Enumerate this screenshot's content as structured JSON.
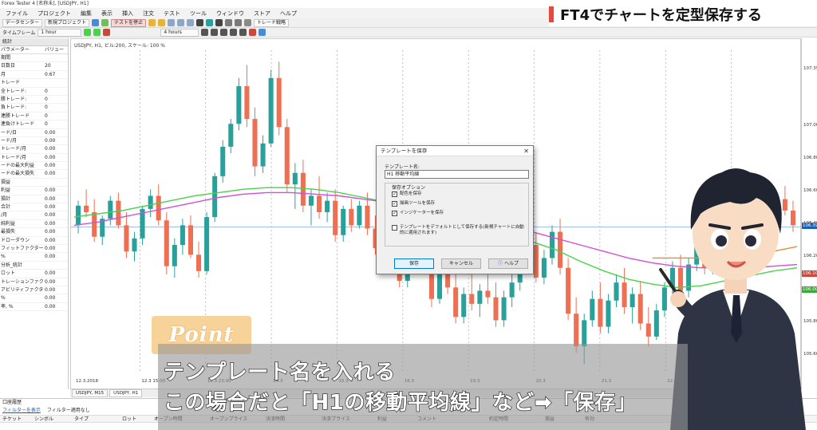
{
  "app": {
    "title": "Forex Tester 4 [名称未], [USDJPY, H1]"
  },
  "menu": [
    "ファイル",
    "プロジェクト",
    "編集",
    "表示",
    "挿入",
    "注文",
    "テスト",
    "ツール",
    "ウィンドウ",
    "ストア",
    "ヘルプ"
  ],
  "toolbar": {
    "data_center": "データセンター",
    "new_project": "新規プロジェクト",
    "test_start": "テストを停止",
    "timeframe_label": "タイムフレーム",
    "timeframe_value": "1 hour",
    "hours_value": "4 hours",
    "trade_strategy": "トレード戦略"
  },
  "banner": {
    "text": "FT4でチャートを定型保存する"
  },
  "left_panel": {
    "title": "統計",
    "col_param": "パラメーター",
    "col_value": "バリュー",
    "rows": [
      {
        "k": "期間",
        "v": ""
      },
      {
        "k": "日数日",
        "v": "20"
      },
      {
        "k": "月",
        "v": "0.67"
      },
      {
        "k": "トレード",
        "v": ""
      },
      {
        "k": "全トレード:",
        "v": "0"
      },
      {
        "k": "勝トレード:",
        "v": "0"
      },
      {
        "k": "負トレード:",
        "v": "0"
      },
      {
        "k": "連勝トレード",
        "v": "0"
      },
      {
        "k": "連負けトレード",
        "v": "0"
      },
      {
        "k": "ード/日",
        "v": "0.00"
      },
      {
        "k": "ード/月",
        "v": "0.00"
      },
      {
        "k": "トレード/月",
        "v": "0.00"
      },
      {
        "k": "トレード/月",
        "v": "0.00"
      },
      {
        "k": "ードの最大利益",
        "v": "0.00"
      },
      {
        "k": "ードの最大損失",
        "v": "0.00"
      },
      {
        "k": "損益",
        "v": ""
      },
      {
        "k": "利益",
        "v": "0.00"
      },
      {
        "k": "損計",
        "v": "0.00"
      },
      {
        "k": "合計",
        "v": "0.00"
      },
      {
        "k": "/月",
        "v": "0.00"
      },
      {
        "k": "純利益",
        "v": "0.00"
      },
      {
        "k": "最損失",
        "v": "0.00"
      },
      {
        "k": "ドローダウン",
        "v": "0.00"
      },
      {
        "k": "フィットファクター",
        "v": "0.00"
      },
      {
        "k": "%",
        "v": "0.00"
      },
      {
        "k": "分析_統計",
        "v": ""
      },
      {
        "k": "ロット",
        "v": "0.00"
      },
      {
        "k": "トレーションファクター",
        "v": "0.00"
      },
      {
        "k": "アビリティファクター",
        "v": "0.00"
      },
      {
        "k": "%",
        "v": "0.00"
      },
      {
        "k": "率, %",
        "v": "0.00"
      }
    ]
  },
  "chart": {
    "label": "USDJPY, H1, ビル:200, スケール: 100 %",
    "price_ticks": [
      "107.35",
      "107.00",
      "106.80",
      "106.60",
      "106.40",
      "106.20",
      "106.00",
      "105.80",
      "105.60"
    ],
    "price_badges": [
      {
        "text": "106.39",
        "color": "#1d5fb3"
      },
      {
        "text": "106.10",
        "color": "#c84a3a"
      },
      {
        "text": "106.00",
        "color": "#3aa83a"
      }
    ],
    "time_ticks": [
      "12.3.2018",
      "12.3 15:00",
      "12.3 23:00",
      "14.3",
      "15.3",
      "16.3",
      "19.3",
      "20.3",
      "21.3",
      "22.3",
      "23.3"
    ],
    "tabs": [
      "USDJPY, M15",
      "USDJPY, H1"
    ]
  },
  "chart_data": {
    "type": "candlestick",
    "title": "",
    "ylim": [
      105.5,
      107.45
    ],
    "up_color": "#2aa09a",
    "down_color": "#ef6f53",
    "candles": [
      [
        106.4,
        106.55,
        106.35,
        106.52
      ],
      [
        106.52,
        106.62,
        106.45,
        106.48
      ],
      [
        106.48,
        106.56,
        106.3,
        106.33
      ],
      [
        106.33,
        106.46,
        106.28,
        106.44
      ],
      [
        106.44,
        106.58,
        106.4,
        106.55
      ],
      [
        106.55,
        106.6,
        106.38,
        106.4
      ],
      [
        106.4,
        106.48,
        106.2,
        106.24
      ],
      [
        106.24,
        106.36,
        106.18,
        106.32
      ],
      [
        106.32,
        106.52,
        106.28,
        106.5
      ],
      [
        106.5,
        106.62,
        106.45,
        106.58
      ],
      [
        106.58,
        106.65,
        106.4,
        106.43
      ],
      [
        106.43,
        106.48,
        106.1,
        106.15
      ],
      [
        106.15,
        106.32,
        106.08,
        106.28
      ],
      [
        106.28,
        106.44,
        106.22,
        106.4
      ],
      [
        106.4,
        106.46,
        106.2,
        106.22
      ],
      [
        106.22,
        106.3,
        106.08,
        106.12
      ],
      [
        106.12,
        106.48,
        106.1,
        106.45
      ],
      [
        106.45,
        106.72,
        106.42,
        106.7
      ],
      [
        106.7,
        106.92,
        106.66,
        106.88
      ],
      [
        106.88,
        107.05,
        106.84,
        107.02
      ],
      [
        107.02,
        107.3,
        106.98,
        107.25
      ],
      [
        107.25,
        107.38,
        107.0,
        107.05
      ],
      [
        107.05,
        107.12,
        106.7,
        106.76
      ],
      [
        106.76,
        106.95,
        106.72,
        106.9
      ],
      [
        106.9,
        107.35,
        106.88,
        107.3
      ],
      [
        107.3,
        107.4,
        106.95,
        107.0
      ],
      [
        107.0,
        107.05,
        106.6,
        106.65
      ],
      [
        106.65,
        106.78,
        106.5,
        106.72
      ],
      [
        106.72,
        106.8,
        106.48,
        106.52
      ],
      [
        106.52,
        106.62,
        106.4,
        106.58
      ],
      [
        106.58,
        106.7,
        106.44,
        106.48
      ],
      [
        106.48,
        106.6,
        106.42,
        106.55
      ],
      [
        106.55,
        106.62,
        106.3,
        106.34
      ],
      [
        106.34,
        106.52,
        106.3,
        106.5
      ],
      [
        106.5,
        106.56,
        106.36,
        106.4
      ],
      [
        106.4,
        106.55,
        106.38,
        106.52
      ],
      [
        106.52,
        106.6,
        106.34,
        106.38
      ],
      [
        106.38,
        106.46,
        106.22,
        106.26
      ],
      [
        106.26,
        106.5,
        106.24,
        106.48
      ],
      [
        106.48,
        106.58,
        106.3,
        106.33
      ],
      [
        106.33,
        106.42,
        106.02,
        106.06
      ],
      [
        106.06,
        106.3,
        106.02,
        106.26
      ],
      [
        106.26,
        106.4,
        106.2,
        106.36
      ],
      [
        106.36,
        106.44,
        106.14,
        106.18
      ],
      [
        106.18,
        106.26,
        105.9,
        105.95
      ],
      [
        105.95,
        106.14,
        105.92,
        106.1
      ],
      [
        106.1,
        106.22,
        105.98,
        106.02
      ],
      [
        106.02,
        106.12,
        105.8,
        105.84
      ],
      [
        105.84,
        106.02,
        105.8,
        105.98
      ],
      [
        105.98,
        106.1,
        105.88,
        105.92
      ],
      [
        105.92,
        106.04,
        105.84,
        106.0
      ],
      [
        106.0,
        106.12,
        105.92,
        105.96
      ],
      [
        105.96,
        106.05,
        105.78,
        105.82
      ],
      [
        105.82,
        106.0,
        105.78,
        105.96
      ],
      [
        105.96,
        106.1,
        105.9,
        106.05
      ],
      [
        106.05,
        106.2,
        106.0,
        106.15
      ],
      [
        106.15,
        106.32,
        106.1,
        106.28
      ],
      [
        106.28,
        106.35,
        106.05,
        106.08
      ],
      [
        106.08,
        106.25,
        106.04,
        106.2
      ],
      [
        106.2,
        106.4,
        106.16,
        106.36
      ],
      [
        106.36,
        106.44,
        106.1,
        106.14
      ],
      [
        106.14,
        106.2,
        105.82,
        105.86
      ],
      [
        105.86,
        105.96,
        105.62,
        105.66
      ],
      [
        105.66,
        105.86,
        105.55,
        105.82
      ],
      [
        105.82,
        106.0,
        105.78,
        105.95
      ],
      [
        105.95,
        106.05,
        105.74,
        105.78
      ],
      [
        105.78,
        105.98,
        105.74,
        105.94
      ],
      [
        105.94,
        106.1,
        105.9,
        106.05
      ],
      [
        106.05,
        106.14,
        105.86,
        105.9
      ],
      [
        105.9,
        106.02,
        105.8,
        105.98
      ],
      [
        105.98,
        106.06,
        105.76,
        105.8
      ],
      [
        105.8,
        105.9,
        105.66,
        105.72
      ],
      [
        105.72,
        105.92,
        105.7,
        105.88
      ],
      [
        105.88,
        106.05,
        105.84,
        106.02
      ],
      [
        106.02,
        106.18,
        105.98,
        106.14
      ],
      [
        106.14,
        106.22,
        105.96,
        106.0
      ],
      [
        106.0,
        106.2,
        105.96,
        106.16
      ],
      [
        106.16,
        106.32,
        106.12,
        106.28
      ],
      [
        106.28,
        106.36,
        106.1,
        106.14
      ],
      [
        106.14,
        106.3,
        106.1,
        106.26
      ],
      [
        106.26,
        106.42,
        106.22,
        106.38
      ],
      [
        106.38,
        106.46,
        106.2,
        106.24
      ],
      [
        106.24,
        106.44,
        106.2,
        106.4
      ],
      [
        106.4,
        106.58,
        106.36,
        106.54
      ],
      [
        106.54,
        106.62,
        106.4,
        106.44
      ],
      [
        106.44,
        106.6,
        106.4,
        106.57
      ],
      [
        106.57,
        106.66,
        106.46,
        106.5
      ],
      [
        106.5,
        106.6,
        106.42,
        106.56
      ],
      [
        106.56,
        106.64,
        106.46,
        106.49
      ],
      [
        106.49,
        106.55,
        106.36,
        106.4
      ]
    ],
    "series": [
      {
        "name": "",
        "color": "#4bd14b",
        "values": [
          106.45,
          106.47,
          106.49,
          106.52,
          106.55,
          106.58,
          106.6,
          106.62,
          106.63,
          106.63,
          106.62,
          106.6,
          106.57,
          106.54,
          106.51,
          106.48,
          106.44,
          106.4,
          106.35,
          106.3,
          106.25,
          106.18,
          106.12,
          106.07,
          106.04,
          106.02,
          106.03,
          106.06,
          106.09,
          106.12,
          106.14
        ]
      },
      {
        "name": "",
        "color": "#d34fd3",
        "values": [
          106.4,
          106.42,
          106.45,
          106.48,
          106.51,
          106.54,
          106.57,
          106.59,
          106.6,
          106.6,
          106.59,
          106.58,
          106.56,
          106.54,
          106.52,
          106.49,
          106.46,
          106.43,
          106.4,
          106.36,
          106.32,
          106.28,
          106.24,
          106.2,
          106.17,
          106.15,
          106.14,
          106.14,
          106.14,
          106.15,
          106.16
        ]
      },
      {
        "name": "",
        "color": "#e68a3a",
        "values": [
          null,
          null,
          null,
          null,
          null,
          null,
          null,
          null,
          null,
          null,
          null,
          null,
          null,
          null,
          null,
          null,
          null,
          null,
          null,
          null,
          null,
          null,
          null,
          null,
          106.2,
          106.2,
          106.2,
          106.21,
          106.22,
          106.24,
          106.27
        ]
      }
    ],
    "hline": 106.39
  },
  "dialog": {
    "title": "テンプレートを保存",
    "name_label": "テンプレート名:",
    "name_value": "H1 移動平均線",
    "group_title": "保存オプション",
    "options": [
      {
        "label": "配色を保存",
        "checked": true
      },
      {
        "label": "描画ツールを保存",
        "checked": true
      },
      {
        "label": "インジケーターを保存",
        "checked": true
      },
      {
        "label": "テンプレートをデフォルトとして保存する(新規チャートに自動的に適用されます)",
        "checked": false
      }
    ],
    "save_label": "保存",
    "cancel_label": "キャンセル",
    "help_label": "ヘルプ"
  },
  "bottom": {
    "title": "口座履歴",
    "filter_link": "フィルターを表示",
    "filter_status": "フィルター適用なし",
    "columns": [
      "チケット",
      "シンボル",
      "タイプ",
      "ロット",
      "オープン時間",
      "オープンプライス",
      "決済時間",
      "決済プライス",
      "利益",
      "コメント",
      "約定時間",
      "損益",
      "有効"
    ]
  },
  "overlay": {
    "point": "Point",
    "line1": "テンプレート名を入れる",
    "line2": "この場合だと「H1の移動平均線」など➡「保存」"
  }
}
